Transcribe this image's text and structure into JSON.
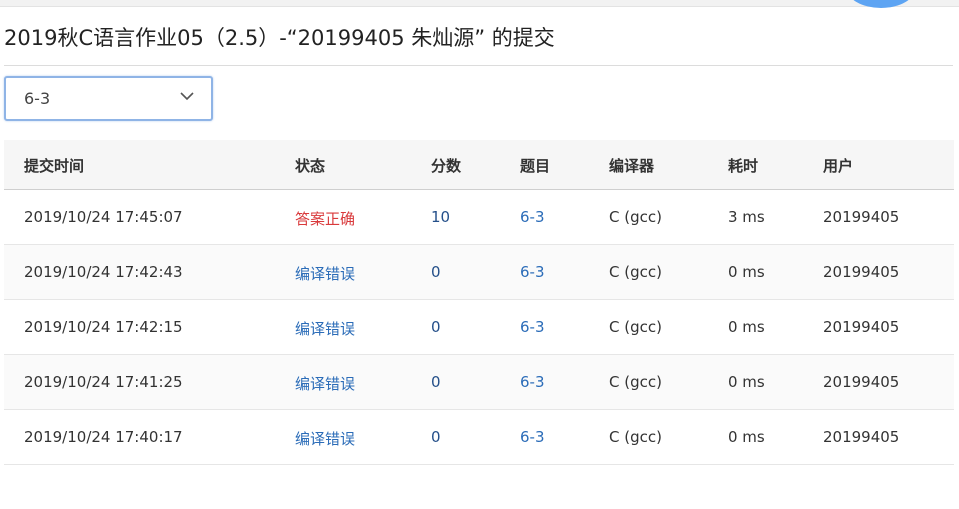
{
  "page": {
    "title": "2019秋C语言作业05（2.5）-“20199405 朱灿源” 的提交"
  },
  "colors": {
    "accent_blue": "#2b6cb8",
    "status_accepted": "#d9393b",
    "status_compile_error": "#2b6cb8"
  },
  "filter": {
    "selected": "6-3",
    "icon": "chevron-down-icon"
  },
  "table": {
    "headers": {
      "time": "提交时间",
      "status": "状态",
      "score": "分数",
      "problem": "题目",
      "compiler": "编译器",
      "duration": "耗时",
      "user": "用户"
    },
    "rows": [
      {
        "time": "2019/10/24 17:45:07",
        "status": "答案正确",
        "score": "10",
        "problem": "6-3",
        "compiler": "C (gcc)",
        "duration": "3 ms",
        "user": "20199405"
      },
      {
        "time": "2019/10/24 17:42:43",
        "status": "编译错误",
        "score": "0",
        "problem": "6-3",
        "compiler": "C (gcc)",
        "duration": "0 ms",
        "user": "20199405"
      },
      {
        "time": "2019/10/24 17:42:15",
        "status": "编译错误",
        "score": "0",
        "problem": "6-3",
        "compiler": "C (gcc)",
        "duration": "0 ms",
        "user": "20199405"
      },
      {
        "time": "2019/10/24 17:41:25",
        "status": "编译错误",
        "score": "0",
        "problem": "6-3",
        "compiler": "C (gcc)",
        "duration": "0 ms",
        "user": "20199405"
      },
      {
        "time": "2019/10/24 17:40:17",
        "status": "编译错误",
        "score": "0",
        "problem": "6-3",
        "compiler": "C (gcc)",
        "duration": "0 ms",
        "user": "20199405"
      }
    ]
  }
}
